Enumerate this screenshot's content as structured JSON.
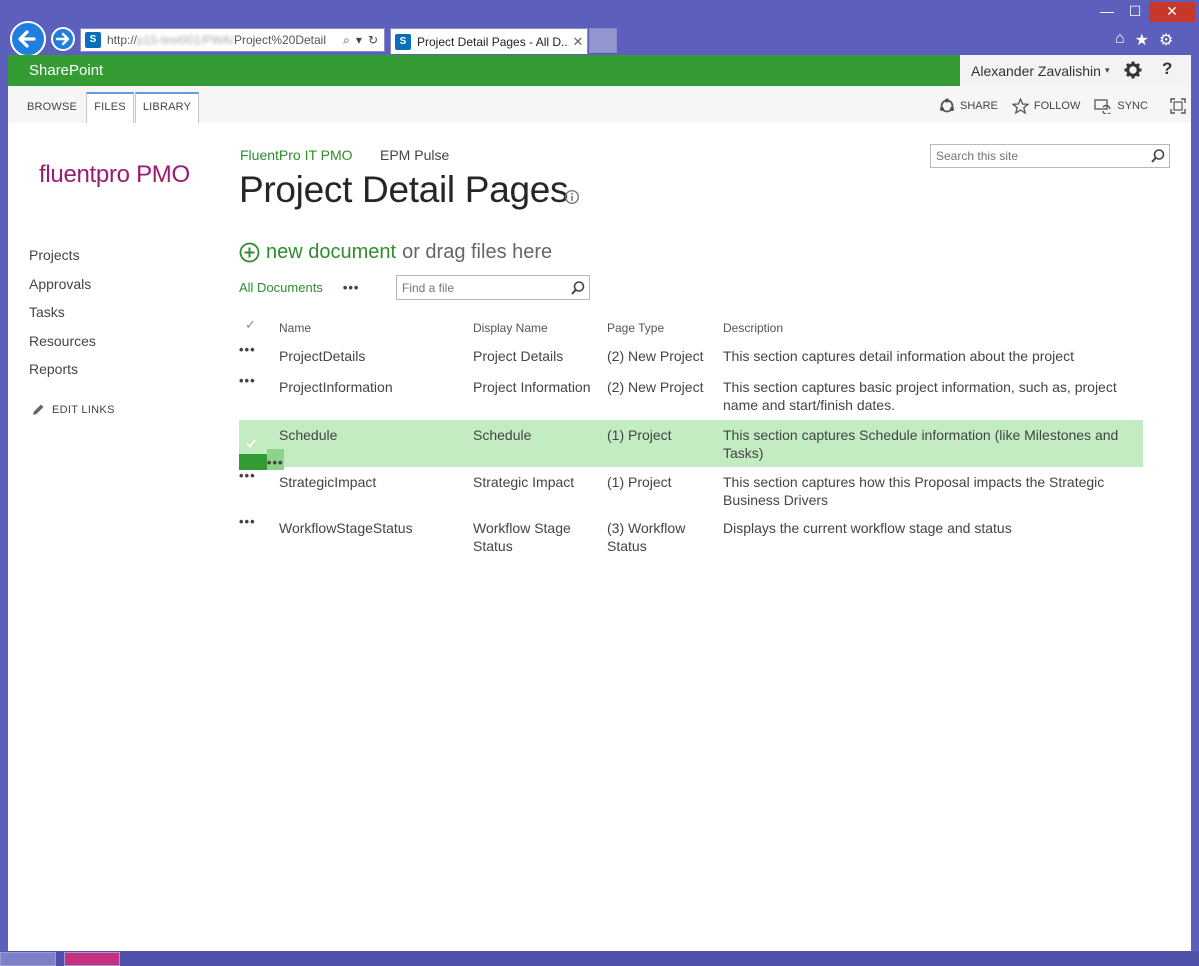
{
  "browser": {
    "address_visible": "http://",
    "address_blurred": "p15-test001/PWA/",
    "address_path": "Project%20Detail",
    "tab_title": "Project Detail Pages - All D...",
    "tab_close": "✕",
    "sp_icon": "S",
    "search_glyph": "⌕",
    "dropdown_glyph": "▾",
    "refresh_glyph": "↻",
    "min": "—",
    "max": "☐",
    "close": "✕",
    "home": "⌂",
    "star": "★",
    "gear": "⚙"
  },
  "suitebar": {
    "brand": "SharePoint",
    "user_name": "Alexander Zavalishin",
    "caret": "▾",
    "help": "?"
  },
  "ribbon": {
    "tabs": [
      "BROWSE",
      "FILES",
      "LIBRARY"
    ],
    "share": "SHARE",
    "follow": "FOLLOW",
    "sync": "SYNC"
  },
  "site": {
    "logo": "fluentpro PMO",
    "topnav": [
      "FluentPro IT PMO",
      "EPM Pulse"
    ],
    "title": "Project Detail Pages",
    "search_placeholder": "Search this site"
  },
  "leftnav": {
    "items": [
      "Projects",
      "Approvals",
      "Tasks",
      "Resources",
      "Reports"
    ],
    "edit_links": "EDIT LINKS"
  },
  "library": {
    "new_document": "new document",
    "drag_text": "or drag files here",
    "view_name": "All Documents",
    "ellipsis": "•••",
    "find_placeholder": "Find a file",
    "columns": {
      "check": "✓",
      "name": "Name",
      "display": "Display Name",
      "type": "Page Type",
      "desc": "Description"
    },
    "rows": [
      {
        "name": "ProjectDetails",
        "display": "Project Details",
        "type": "(2) New Project",
        "desc": "This section captures detail information about the project",
        "selected": false
      },
      {
        "name": "ProjectInformation",
        "display": "Project Information",
        "type": "(2) New Project",
        "desc": "This section captures basic project information, such as, project name and start/finish dates.",
        "selected": false
      },
      {
        "name": "Schedule",
        "display": "Schedule",
        "type": "(1) Project",
        "desc": "This section captures Schedule information (like Milestones and Tasks)",
        "selected": true
      },
      {
        "name": "StrategicImpact",
        "display": "Strategic Impact",
        "type": "(1) Project",
        "desc": "This section captures how this Proposal impacts the Strategic Business Drivers",
        "selected": false
      },
      {
        "name": "WorkflowStageStatus",
        "display": "Workflow Stage Status",
        "type": "(3) Workflow Status",
        "desc": "Displays the current workflow stage and status",
        "selected": false
      }
    ]
  },
  "colors": {
    "accent_green": "#359b33",
    "link_green": "#2f8d2d",
    "selected_row": "#c4ecc3",
    "window_frame": "#5c5fbb",
    "logo_magenta": "#9a1b6f"
  }
}
